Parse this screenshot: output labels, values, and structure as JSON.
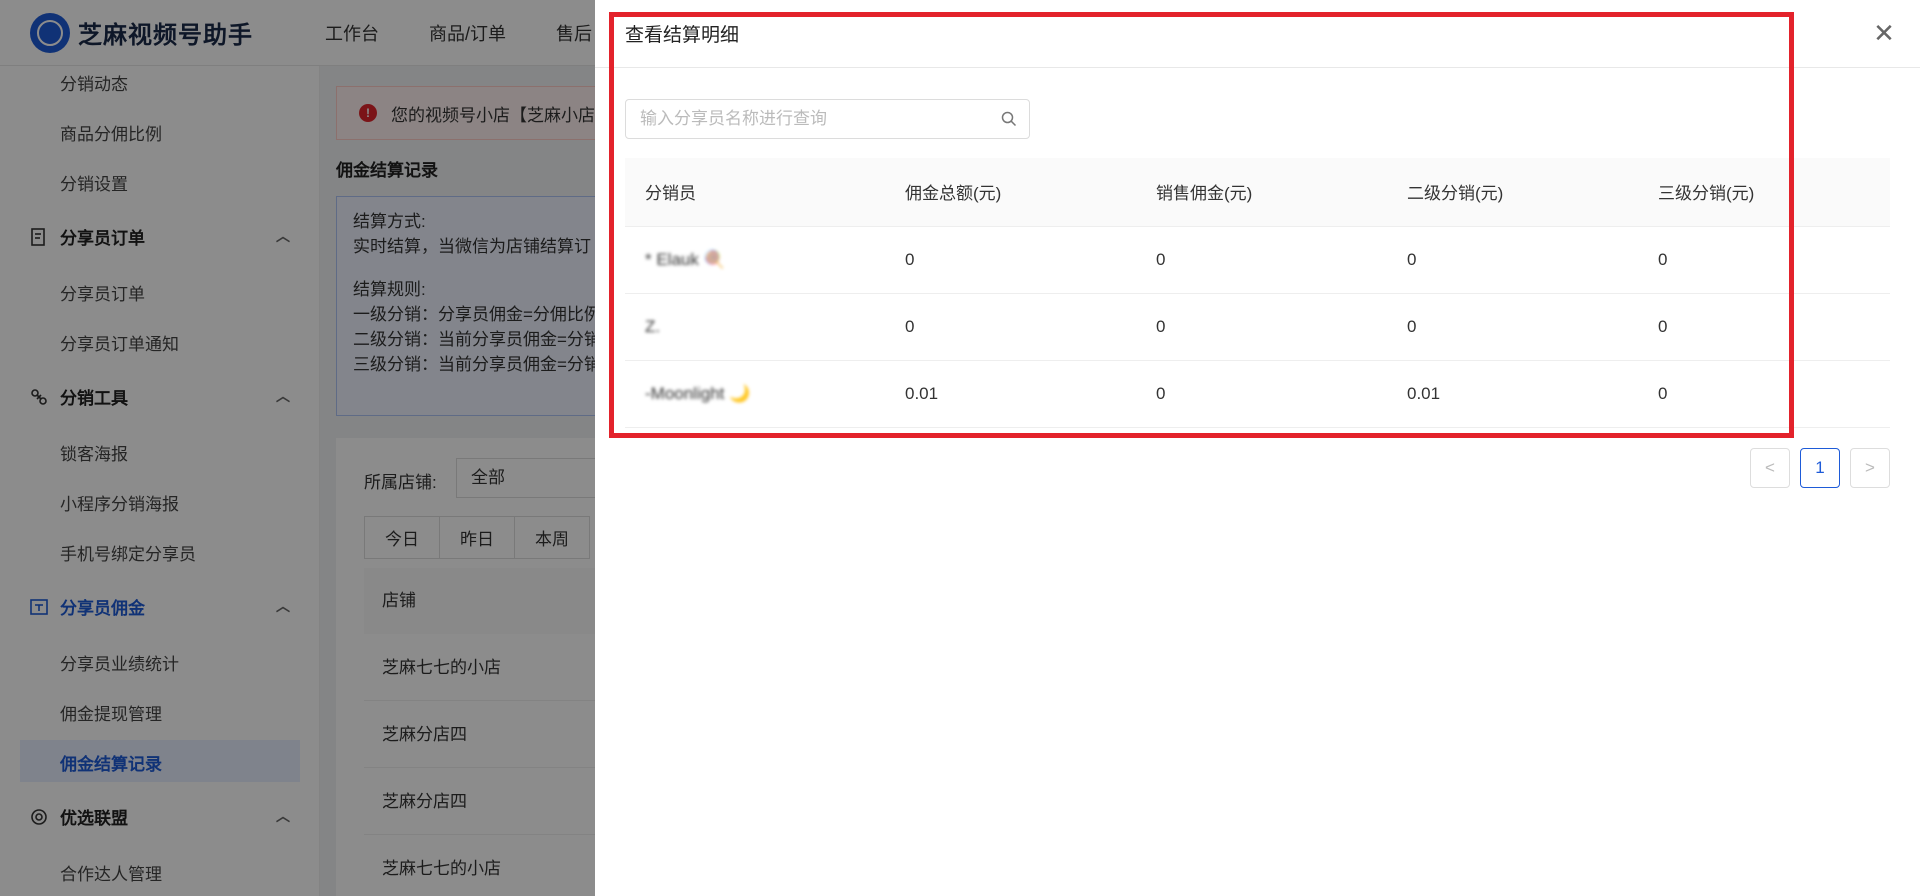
{
  "app": {
    "title": "芝麻视频号助手"
  },
  "topnav": [
    "工作台",
    "商品/订单",
    "售后"
  ],
  "sidebar": {
    "items_top": [
      "分销动态",
      "商品分佣比例",
      "分销设置"
    ],
    "group_orders": "分享员订单",
    "orders_items": [
      "分享员订单",
      "分享员订单通知"
    ],
    "group_tools": "分销工具",
    "tools_items": [
      "锁客海报",
      "小程序分销海报",
      "手机号绑定分享员"
    ],
    "group_commission": "分享员佣金",
    "commission_items": [
      "分享员业绩统计",
      "佣金提现管理",
      "佣金结算记录"
    ],
    "group_alliance": "优选联盟",
    "alliance_items": [
      "合作达人管理"
    ]
  },
  "main": {
    "alert_text": "您的视频号小店【芝麻小店",
    "section_title": "佣金结算记录",
    "info_lines": [
      "结算方式:",
      "实时结算，当微信为店铺结算订",
      "",
      "结算规则:",
      "一级分销：分享员佣金=分佣比例",
      "二级分销：当前分享员佣金=分销",
      "三级分销：当前分享员佣金=分销"
    ],
    "filter_label": "所属店铺:",
    "filter_value": "全部",
    "date_tabs": [
      "今日",
      "昨日",
      "本周"
    ],
    "store_header": "店铺",
    "stores": [
      "芝麻七七的小店",
      "芝麻分店四",
      "芝麻分店四",
      "芝麻七七的小店"
    ]
  },
  "drawer": {
    "title": "查看结算明细",
    "search_placeholder": "输入分享员名称进行查询",
    "columns": [
      "分销员",
      "佣金总额(元)",
      "销售佣金(元)",
      "二级分销(元)",
      "三级分销(元)"
    ],
    "rows": [
      [
        "* Elauk 🍭",
        "0",
        "0",
        "0",
        "0"
      ],
      [
        "Z.",
        "0",
        "0",
        "0",
        "0"
      ],
      [
        "-Moonlight 🌙",
        "0.01",
        "0",
        "0.01",
        "0"
      ]
    ],
    "pagination": {
      "current": "1"
    }
  },
  "colors": {
    "accent": "#1e5bd8",
    "highlight": "#e3222b"
  }
}
